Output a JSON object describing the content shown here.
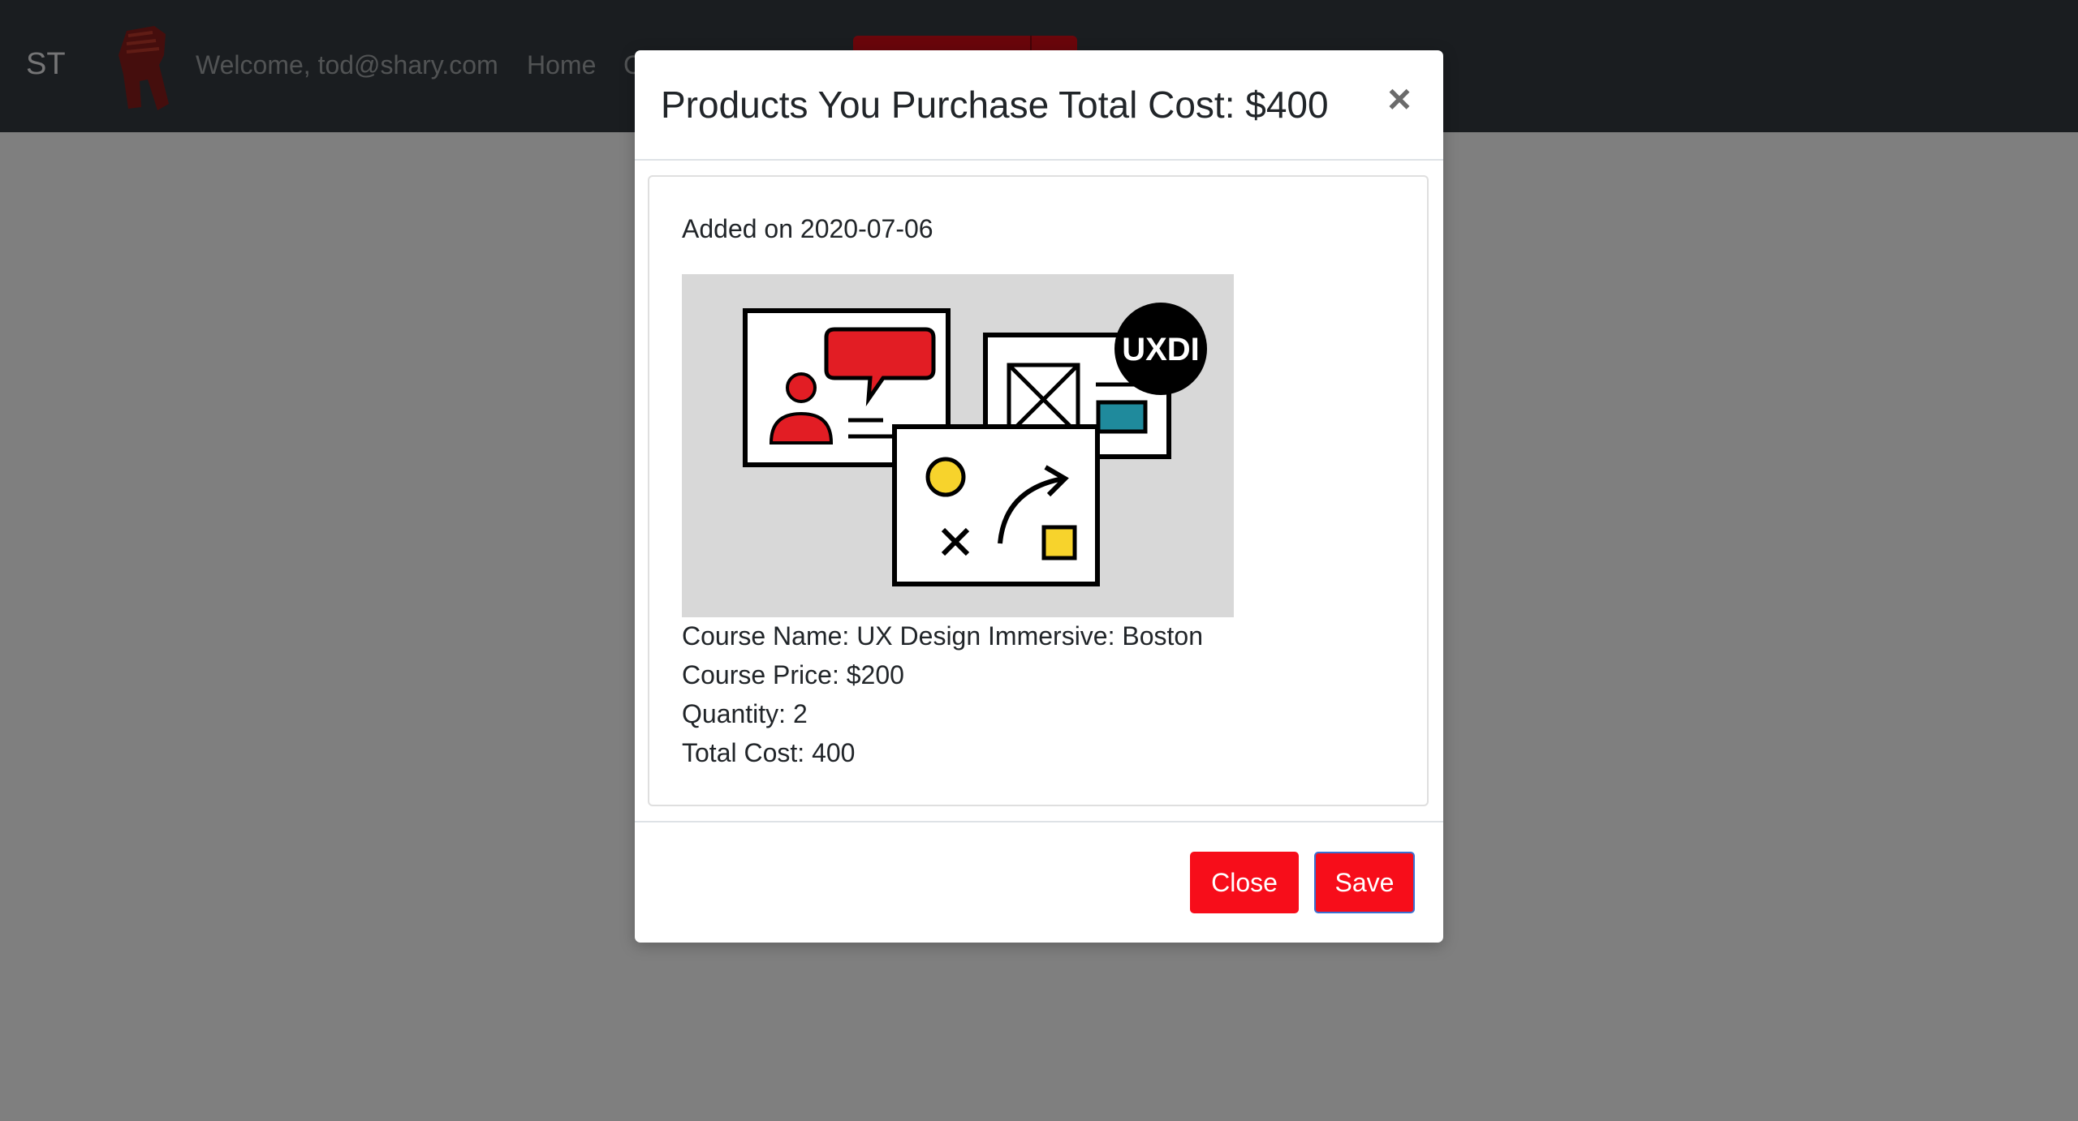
{
  "navbar": {
    "brand": "ST",
    "welcome": "Welcome, tod@shary.com",
    "home": "Home",
    "partial_link": "C"
  },
  "modal": {
    "title": "Products You Purchase Total Cost: $400",
    "close_symbol": "×",
    "item": {
      "added_on": "Added on 2020-07-06",
      "image_badge": "UXDI",
      "course_name": "Course Name: UX Design Immersive: Boston",
      "course_price": "Course Price: $200",
      "quantity": "Quantity: 2",
      "total_cost": "Total Cost: 400"
    },
    "buttons": {
      "close": "Close",
      "save": "Save"
    }
  },
  "colors": {
    "navbar": "#343a40",
    "accent_red": "#f70d1a",
    "image_bg": "#d8d8d8",
    "illus_red": "#e21d24",
    "illus_yellow": "#f7d32c",
    "illus_teal": "#1f8a9c"
  }
}
